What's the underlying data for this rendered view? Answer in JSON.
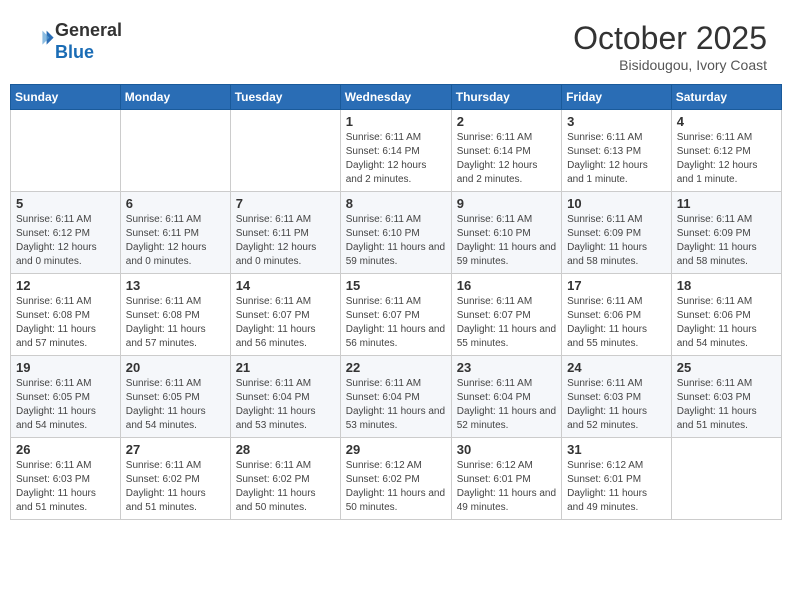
{
  "header": {
    "logo_line1": "General",
    "logo_line2": "Blue",
    "month": "October 2025",
    "location": "Bisidougou, Ivory Coast"
  },
  "days_of_week": [
    "Sunday",
    "Monday",
    "Tuesday",
    "Wednesday",
    "Thursday",
    "Friday",
    "Saturday"
  ],
  "weeks": [
    [
      {
        "day": "",
        "info": ""
      },
      {
        "day": "",
        "info": ""
      },
      {
        "day": "",
        "info": ""
      },
      {
        "day": "1",
        "info": "Sunrise: 6:11 AM\nSunset: 6:14 PM\nDaylight: 12 hours and 2 minutes."
      },
      {
        "day": "2",
        "info": "Sunrise: 6:11 AM\nSunset: 6:14 PM\nDaylight: 12 hours and 2 minutes."
      },
      {
        "day": "3",
        "info": "Sunrise: 6:11 AM\nSunset: 6:13 PM\nDaylight: 12 hours and 1 minute."
      },
      {
        "day": "4",
        "info": "Sunrise: 6:11 AM\nSunset: 6:12 PM\nDaylight: 12 hours and 1 minute."
      }
    ],
    [
      {
        "day": "5",
        "info": "Sunrise: 6:11 AM\nSunset: 6:12 PM\nDaylight: 12 hours and 0 minutes."
      },
      {
        "day": "6",
        "info": "Sunrise: 6:11 AM\nSunset: 6:11 PM\nDaylight: 12 hours and 0 minutes."
      },
      {
        "day": "7",
        "info": "Sunrise: 6:11 AM\nSunset: 6:11 PM\nDaylight: 12 hours and 0 minutes."
      },
      {
        "day": "8",
        "info": "Sunrise: 6:11 AM\nSunset: 6:10 PM\nDaylight: 11 hours and 59 minutes."
      },
      {
        "day": "9",
        "info": "Sunrise: 6:11 AM\nSunset: 6:10 PM\nDaylight: 11 hours and 59 minutes."
      },
      {
        "day": "10",
        "info": "Sunrise: 6:11 AM\nSunset: 6:09 PM\nDaylight: 11 hours and 58 minutes."
      },
      {
        "day": "11",
        "info": "Sunrise: 6:11 AM\nSunset: 6:09 PM\nDaylight: 11 hours and 58 minutes."
      }
    ],
    [
      {
        "day": "12",
        "info": "Sunrise: 6:11 AM\nSunset: 6:08 PM\nDaylight: 11 hours and 57 minutes."
      },
      {
        "day": "13",
        "info": "Sunrise: 6:11 AM\nSunset: 6:08 PM\nDaylight: 11 hours and 57 minutes."
      },
      {
        "day": "14",
        "info": "Sunrise: 6:11 AM\nSunset: 6:07 PM\nDaylight: 11 hours and 56 minutes."
      },
      {
        "day": "15",
        "info": "Sunrise: 6:11 AM\nSunset: 6:07 PM\nDaylight: 11 hours and 56 minutes."
      },
      {
        "day": "16",
        "info": "Sunrise: 6:11 AM\nSunset: 6:07 PM\nDaylight: 11 hours and 55 minutes."
      },
      {
        "day": "17",
        "info": "Sunrise: 6:11 AM\nSunset: 6:06 PM\nDaylight: 11 hours and 55 minutes."
      },
      {
        "day": "18",
        "info": "Sunrise: 6:11 AM\nSunset: 6:06 PM\nDaylight: 11 hours and 54 minutes."
      }
    ],
    [
      {
        "day": "19",
        "info": "Sunrise: 6:11 AM\nSunset: 6:05 PM\nDaylight: 11 hours and 54 minutes."
      },
      {
        "day": "20",
        "info": "Sunrise: 6:11 AM\nSunset: 6:05 PM\nDaylight: 11 hours and 54 minutes."
      },
      {
        "day": "21",
        "info": "Sunrise: 6:11 AM\nSunset: 6:04 PM\nDaylight: 11 hours and 53 minutes."
      },
      {
        "day": "22",
        "info": "Sunrise: 6:11 AM\nSunset: 6:04 PM\nDaylight: 11 hours and 53 minutes."
      },
      {
        "day": "23",
        "info": "Sunrise: 6:11 AM\nSunset: 6:04 PM\nDaylight: 11 hours and 52 minutes."
      },
      {
        "day": "24",
        "info": "Sunrise: 6:11 AM\nSunset: 6:03 PM\nDaylight: 11 hours and 52 minutes."
      },
      {
        "day": "25",
        "info": "Sunrise: 6:11 AM\nSunset: 6:03 PM\nDaylight: 11 hours and 51 minutes."
      }
    ],
    [
      {
        "day": "26",
        "info": "Sunrise: 6:11 AM\nSunset: 6:03 PM\nDaylight: 11 hours and 51 minutes."
      },
      {
        "day": "27",
        "info": "Sunrise: 6:11 AM\nSunset: 6:02 PM\nDaylight: 11 hours and 51 minutes."
      },
      {
        "day": "28",
        "info": "Sunrise: 6:11 AM\nSunset: 6:02 PM\nDaylight: 11 hours and 50 minutes."
      },
      {
        "day": "29",
        "info": "Sunrise: 6:12 AM\nSunset: 6:02 PM\nDaylight: 11 hours and 50 minutes."
      },
      {
        "day": "30",
        "info": "Sunrise: 6:12 AM\nSunset: 6:01 PM\nDaylight: 11 hours and 49 minutes."
      },
      {
        "day": "31",
        "info": "Sunrise: 6:12 AM\nSunset: 6:01 PM\nDaylight: 11 hours and 49 minutes."
      },
      {
        "day": "",
        "info": ""
      }
    ]
  ]
}
